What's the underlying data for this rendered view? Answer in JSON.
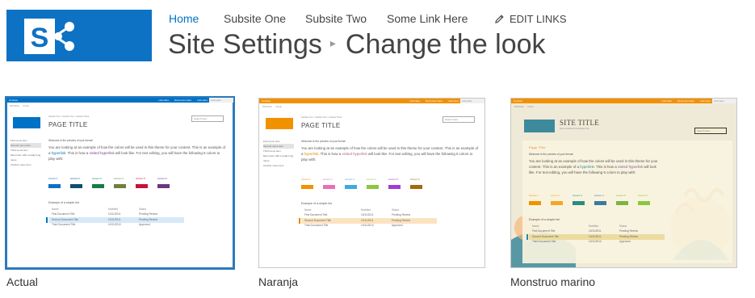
{
  "nav": {
    "items": [
      "Home",
      "Subsite One",
      "Subsite Two",
      "Some Link Here"
    ],
    "edit_links": "EDIT LINKS"
  },
  "title": {
    "parent": "Site Settings",
    "current": "Change the look"
  },
  "preview_text": {
    "suitebar_label": "Contoso",
    "suite_links": [
      "Link Here",
      "Document Here",
      "Link Here"
    ],
    "sharebox": "Link Here",
    "ribbon": [
      "BROWSE",
      "PAGE"
    ],
    "crumbs": "Subsite One > Subsite Two > Subsite Three",
    "page_title": "PAGE TITLE",
    "site_title": "SITE TITLE",
    "site_subtitle": "Home   Subsite One   Subsite Two",
    "search": "Search here",
    "left_nav": [
      "First menu item",
      "Second menu item",
      "Third menu item",
      "Menu item with a really long name",
      "Another menu item"
    ],
    "welcome": "Welcome to the preview of your theme!",
    "body_1": "You are looking at an example of how the colors will be used in this theme for your content. This is an example of a",
    "hyperlink": "hyperlink",
    "body_2": ". This is how a",
    "visited": "visited hyperlink",
    "body_3": "will look like. For text editing, you will have the following 6 colors to play with:",
    "accents": [
      "Accent 1",
      "Accent 2",
      "Accent 3",
      "Accent 4",
      "Accent 5",
      "Accent 6"
    ],
    "list_caption": "Example of a simple list",
    "list_headers": [
      "Name",
      "Modified",
      "Status"
    ],
    "list_rows": [
      [
        "First Document Title",
        "10/11/2011",
        "Pending Review"
      ],
      [
        "Second Document Title",
        "10/11/2011",
        "Pending Review"
      ],
      [
        "Third Document Title",
        "10/11/2010",
        "Approved"
      ]
    ],
    "monstruo_page_title": "Page Title"
  },
  "themes": [
    {
      "name": "Actual",
      "selected": true,
      "suitebar_color": "#0072c6",
      "logo_color": "#0072c6",
      "link_color": "#0072c6",
      "visited_color": "#7e3a8f",
      "highlight_color": "#d6e9f8",
      "accent_colors": [
        "#0f6fc6",
        "#0d4f6c",
        "#177c48",
        "#6f7f3d",
        "#c8113d",
        "#6c3682"
      ]
    },
    {
      "name": "Naranja",
      "selected": false,
      "suitebar_color": "#f29100",
      "logo_color": "#f29100",
      "link_color": "#e08a00",
      "visited_color": "#b5618b",
      "highlight_color": "#fbe3bf",
      "accent_colors": [
        "#f29100",
        "#e86fb9",
        "#3fa9e0",
        "#8cc63f",
        "#a23bd6",
        "#a3690c"
      ]
    },
    {
      "name": "Monstruo marino",
      "selected": false,
      "suitebar_color": "#f29100",
      "logo_color": "#3d8a9c",
      "link_color": "#2a8aa8",
      "visited_color": "#8b5aa8",
      "highlight_color": "#ecdca0",
      "accent_colors": [
        "#f29100",
        "#f5a623",
        "#2f8a83",
        "#3b7a9c",
        "#7ab640",
        "#8cc63f"
      ]
    }
  ]
}
